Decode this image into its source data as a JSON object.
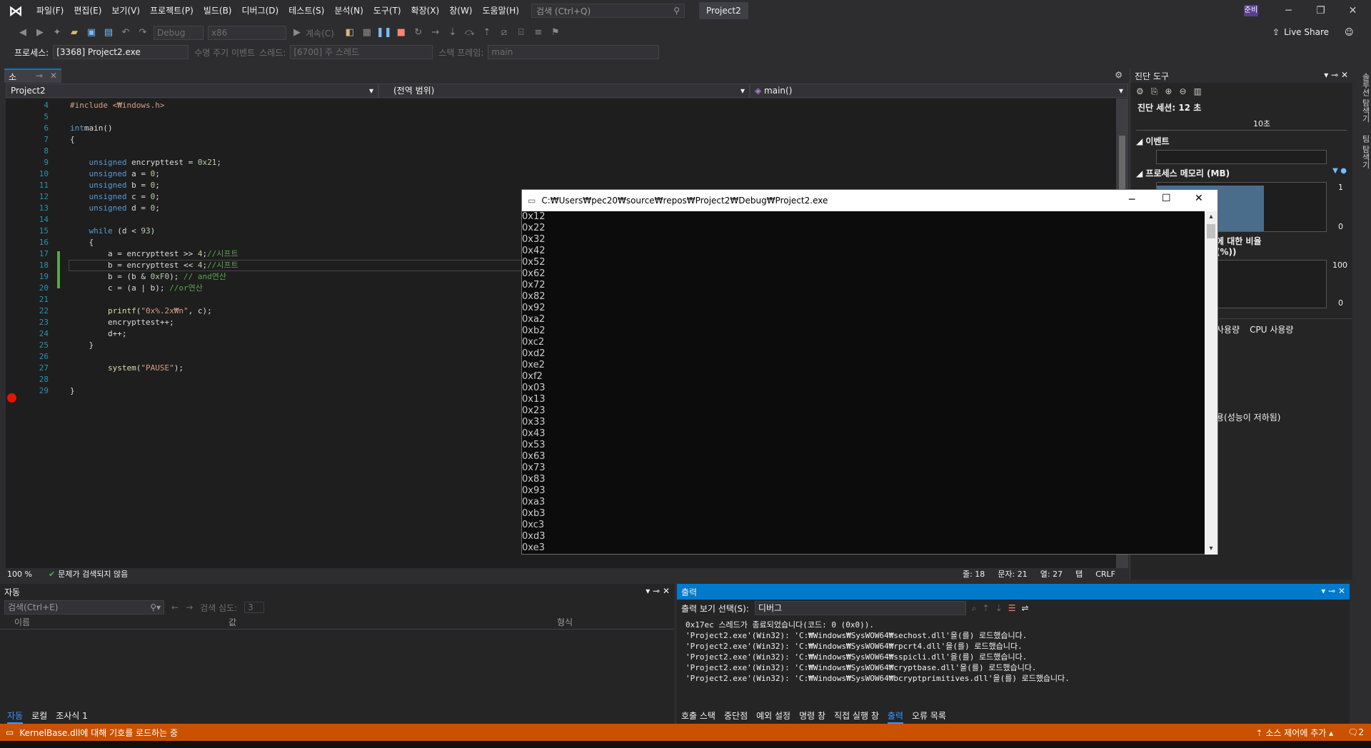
{
  "menubar": {
    "items": [
      "파일(F)",
      "편집(E)",
      "보기(V)",
      "프로젝트(P)",
      "빌드(B)",
      "디버그(D)",
      "테스트(S)",
      "분석(N)",
      "도구(T)",
      "확장(X)",
      "창(W)",
      "도움말(H)"
    ],
    "search_placeholder": "검색 (Ctrl+Q)",
    "project_name": "Project2",
    "user_badge": "준비"
  },
  "toolbar": {
    "config": "Debug",
    "platform": "x86",
    "continue_label": "계속(C)",
    "live_share": "Live Share"
  },
  "debug_bar": {
    "process_label": "프로세스:",
    "process_value": "[3368] Project2.exe",
    "lifecycle_label": "수명 주기 이벤트",
    "thread_label": "스레드:",
    "thread_value": "[6700] 주 스레드",
    "stack_label": "스택 프레임:",
    "stack_value": "main"
  },
  "editor": {
    "tab_name": "소스.c",
    "nav_project": "Project2",
    "nav_scope": "(전역 범위)",
    "nav_func": "main()",
    "zoom": "100 %",
    "issues": "문제가 검색되지 않음",
    "line_info": "줄: 18",
    "char_info": "문자: 21",
    "col_info": "열: 27",
    "tab_info": "탭",
    "eol": "CRLF",
    "line_numbers": [
      "4",
      "5",
      "6",
      "7",
      "8",
      "9",
      "10",
      "11",
      "12",
      "13",
      "14",
      "15",
      "16",
      "17",
      "18",
      "19",
      "20",
      "21",
      "22",
      "23",
      "24",
      "25",
      "26",
      "27",
      "28",
      "29"
    ],
    "code": [
      {
        "parts": [
          [
            "inc",
            "#include <₩indows.h>"
          ]
        ]
      },
      {
        "parts": []
      },
      {
        "parts": [
          [
            "kw",
            "int"
          ],
          [
            "",
            "main()"
          ]
        ]
      },
      {
        "parts": [
          [
            "",
            "{"
          ]
        ]
      },
      {
        "parts": []
      },
      {
        "parts": [
          [
            "",
            "    "
          ],
          [
            "kw",
            "unsigned"
          ],
          [
            "",
            " encrypttest = "
          ],
          [
            "num",
            "0x21"
          ],
          [
            "",
            ";"
          ]
        ]
      },
      {
        "parts": [
          [
            "",
            "    "
          ],
          [
            "kw",
            "unsigned"
          ],
          [
            "",
            " a = "
          ],
          [
            "num",
            "0"
          ],
          [
            "",
            ";"
          ]
        ]
      },
      {
        "parts": [
          [
            "",
            "    "
          ],
          [
            "kw",
            "unsigned"
          ],
          [
            "",
            " b = "
          ],
          [
            "num",
            "0"
          ],
          [
            "",
            ";"
          ]
        ]
      },
      {
        "parts": [
          [
            "",
            "    "
          ],
          [
            "kw",
            "unsigned"
          ],
          [
            "",
            " c = "
          ],
          [
            "num",
            "0"
          ],
          [
            "",
            ";"
          ]
        ]
      },
      {
        "parts": [
          [
            "",
            "    "
          ],
          [
            "kw",
            "unsigned"
          ],
          [
            "",
            " d = "
          ],
          [
            "num",
            "0"
          ],
          [
            "",
            ";"
          ]
        ]
      },
      {
        "parts": []
      },
      {
        "parts": [
          [
            "",
            "    "
          ],
          [
            "kw",
            "while"
          ],
          [
            "",
            " (d < "
          ],
          [
            "num",
            "93"
          ],
          [
            "",
            ")"
          ]
        ]
      },
      {
        "parts": [
          [
            "",
            "    {"
          ]
        ]
      },
      {
        "parts": [
          [
            "",
            "        a = encrypttest >> "
          ],
          [
            "num",
            "4"
          ],
          [
            "",
            ";"
          ],
          [
            "cmt",
            "//시프트"
          ]
        ]
      },
      {
        "parts": [
          [
            "",
            "        b = encrypttest << "
          ],
          [
            "num",
            "4"
          ],
          [
            "",
            ";"
          ],
          [
            "cmt",
            "//시프트"
          ]
        ]
      },
      {
        "parts": [
          [
            "",
            "        b = (b & "
          ],
          [
            "num",
            "0xF0"
          ],
          [
            "",
            "); "
          ],
          [
            "cmt",
            "// and연산"
          ]
        ]
      },
      {
        "parts": [
          [
            "",
            "        c = (a | b); "
          ],
          [
            "cmt",
            "//or연산"
          ]
        ]
      },
      {
        "parts": []
      },
      {
        "parts": [
          [
            "",
            "        "
          ],
          [
            "fn",
            "printf"
          ],
          [
            "",
            "("
          ],
          [
            "str",
            "\"0x%.2x₩n\""
          ],
          [
            "",
            ", c);"
          ]
        ]
      },
      {
        "parts": [
          [
            "",
            "        encrypttest++;"
          ]
        ]
      },
      {
        "parts": [
          [
            "",
            "        d++;"
          ]
        ]
      },
      {
        "parts": [
          [
            "",
            "    }"
          ]
        ]
      },
      {
        "parts": []
      },
      {
        "parts": [
          [
            "",
            "        "
          ],
          [
            "fn",
            "system"
          ],
          [
            "",
            "("
          ],
          [
            "str",
            "\"PAUSE\""
          ],
          [
            "",
            ");"
          ]
        ]
      },
      {
        "parts": []
      },
      {
        "parts": [
          [
            "",
            "}"
          ]
        ]
      }
    ]
  },
  "console": {
    "title": "C:₩Users₩pec20₩source₩repos₩Project2₩Debug₩Project2.exe",
    "lines": [
      "0x12",
      "0x22",
      "0x32",
      "0x42",
      "0x52",
      "0x62",
      "0x72",
      "0x82",
      "0x92",
      "0xa2",
      "0xb2",
      "0xc2",
      "0xd2",
      "0xe2",
      "0xf2",
      "0x03",
      "0x13",
      "0x23",
      "0x33",
      "0x43",
      "0x53",
      "0x63",
      "0x73",
      "0x83",
      "0x93",
      "0xa3",
      "0xb3",
      "0xc3",
      "0xd3",
      "0xe3"
    ]
  },
  "diagnostics": {
    "title": "진단 도구",
    "session": "진단 세션: 12 초",
    "timeline_label": "10초",
    "events_label": "이벤트",
    "memory_label": "프로세스 메모리 (MB)",
    "mem_max": "1",
    "mem_min": "0",
    "cpu_label": "에 대한 비율(%))",
    "cpu_max": "100",
    "cpu_min": "0",
    "tab_memory": "사용량",
    "tab_cpu": "CPU 사용량",
    "perf_note": "용(성능이 저하됨)"
  },
  "side_rail": [
    "솔루션 탐색기",
    "팀 탐색기"
  ],
  "auto_panel": {
    "title": "자동",
    "search_placeholder": "검색(Ctrl+E)",
    "depth_label": "검색 심도:",
    "depth_value": "3",
    "col_name": "이름",
    "col_value": "값",
    "col_type": "형식",
    "tabs": [
      "자동",
      "로컬",
      "조사식 1"
    ]
  },
  "output_panel": {
    "title": "출력",
    "show_label": "출력 보기 선택(S):",
    "show_value": "디버그",
    "lines": [
      "0x17ec 스레드가 종료되었습니다(코드: 0 (0x0)).",
      "'Project2.exe'(Win32): 'C:₩Windows₩SysWOW64₩sechost.dll'을(를) 로드했습니다.",
      "'Project2.exe'(Win32): 'C:₩Windows₩SysWOW64₩rpcrt4.dll'을(를) 로드했습니다.",
      "'Project2.exe'(Win32): 'C:₩Windows₩SysWOW64₩sspicli.dll'을(를) 로드했습니다.",
      "'Project2.exe'(Win32): 'C:₩Windows₩SysWOW64₩cryptbase.dll'을(를) 로드했습니다.",
      "'Project2.exe'(Win32): 'C:₩Windows₩SysWOW64₩bcryptprimitives.dll'을(를) 로드했습니다."
    ],
    "tabs": [
      "호출 스택",
      "중단점",
      "예외 설정",
      "명령 창",
      "직접 실행 창",
      "출력",
      "오류 목록"
    ]
  },
  "statusbar": {
    "message": "KernelBase.dll에 대해 기호를 로드하는 중",
    "source_control": "소스 제어에 추가",
    "notif_count": "2"
  }
}
